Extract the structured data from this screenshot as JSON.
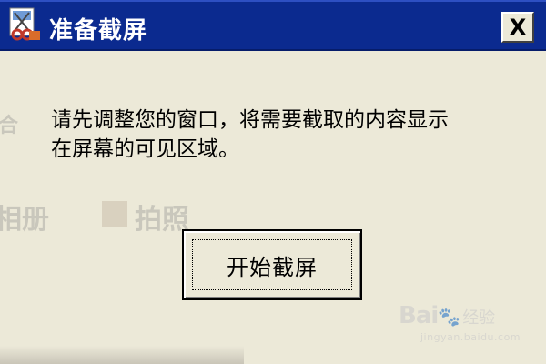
{
  "window": {
    "title": "准备截屏",
    "close_label": "X"
  },
  "dialog": {
    "message_line1": "请先调整您的窗口，将需要截取的内容显示",
    "message_line2": "在屏幕的可见区域。",
    "start_button_label": "开始截屏"
  },
  "background_app": {
    "fragment_1": "合",
    "fragment_2": "相册",
    "fragment_3": "拍照"
  },
  "watermark": {
    "brand": "Bai",
    "name": "经验",
    "url": "jingyan.baidu.com"
  },
  "colors": {
    "titlebar": "#0b2a8f",
    "dialog_bg": "#ece9d8",
    "text": "#000000"
  },
  "icons": {
    "app": "scissors-screenshot-icon",
    "close": "close-icon",
    "watermark": "paw-icon"
  }
}
